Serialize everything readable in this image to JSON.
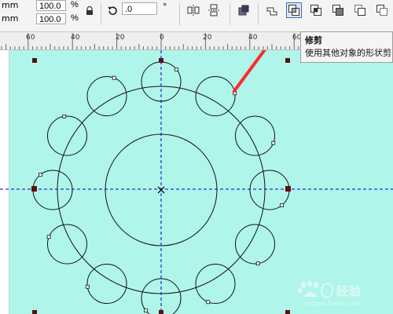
{
  "propbar": {
    "unit_top": "mm",
    "unit_bottom": "mm",
    "scale_x": "100.0",
    "scale_y": "100.0",
    "pct_top": "%",
    "pct_bottom": "%",
    "rotation_value": ".0",
    "degree_symbol": "°",
    "buttons": [
      {
        "name": "lock-ratio-icon"
      },
      {
        "name": "rotate-icon"
      },
      {
        "name": "mirror-horizontal-icon"
      },
      {
        "name": "mirror-vertical-icon"
      },
      {
        "name": "combine-icon"
      },
      {
        "name": "weld-icon"
      },
      {
        "name": "trim-icon",
        "active": true
      },
      {
        "name": "intersect-icon"
      },
      {
        "name": "simplify-icon"
      },
      {
        "name": "front-minus-back-icon"
      },
      {
        "name": "back-minus-front-icon"
      }
    ]
  },
  "ruler": {
    "labels": [
      "60",
      "40",
      "20",
      "0",
      "20",
      "40",
      "60"
    ]
  },
  "tooltip": {
    "title": "修剪",
    "description": "使用其他对象的形状剪"
  },
  "watermark": {
    "text": "经验",
    "url": "jingyan.baidu.com"
  },
  "colors": {
    "canvas": "#aff5e9",
    "guide_line": "#0000cc",
    "arrow": "#ff2a2a",
    "handle": "#5a1010"
  }
}
